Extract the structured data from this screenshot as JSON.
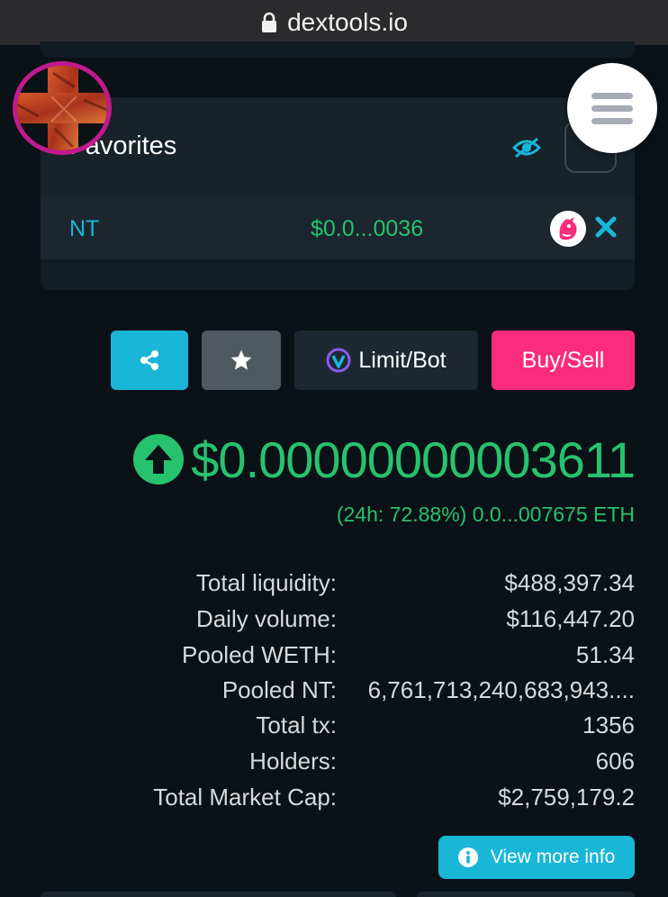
{
  "browser": {
    "url": "dextools.io"
  },
  "favorites": {
    "title": "Favorites",
    "items": [
      {
        "name": "NT",
        "price": "$0.0...0036"
      }
    ]
  },
  "actions": {
    "limit_bot_label": "Limit/Bot",
    "buy_sell_label": "Buy/Sell"
  },
  "token": {
    "price": "$0.00000000003611",
    "change": "(24h: 72.88%) 0.0...007675 ETH",
    "trend": "up"
  },
  "stats": [
    {
      "label": "Total liquidity:",
      "value": "$488,397.34"
    },
    {
      "label": "Daily volume:",
      "value": "$116,447.20"
    },
    {
      "label": "Pooled WETH:",
      "value": "51.34"
    },
    {
      "label": "Pooled NT:",
      "value": "6,761,713,240,683,943...."
    },
    {
      "label": "Total tx:",
      "value": "1356"
    },
    {
      "label": "Holders:",
      "value": "606"
    },
    {
      "label": "Total Market Cap:",
      "value": "$2,759,179.2"
    }
  ],
  "more_info_label": "View more info",
  "colors": {
    "background": "#0b1217",
    "accent_cyan": "#19b6d8",
    "positive_green": "#27c26e",
    "buy_pink": "#fc2c7c"
  },
  "icons": [
    "lock-icon",
    "hide-eye-icon",
    "uniswap-icon",
    "close-icon",
    "share-icon",
    "star-icon",
    "dextools-logo-icon",
    "arrow-up-circle-icon",
    "info-icon",
    "hamburger-menu-icon",
    "cross-badge-icon"
  ]
}
